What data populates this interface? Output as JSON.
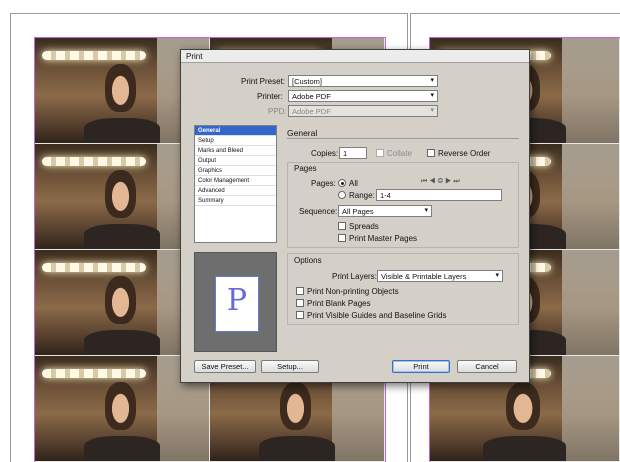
{
  "dialog": {
    "title": "Print",
    "print_preset_label": "Print Preset:",
    "print_preset_value": "[Custom]",
    "printer_label": "Printer:",
    "printer_value": "Adobe PDF",
    "ppd_label": "PPD:",
    "ppd_value": "Adobe PDF"
  },
  "sidebar": {
    "items": [
      {
        "label": "General"
      },
      {
        "label": "Setup"
      },
      {
        "label": "Marks and Bleed"
      },
      {
        "label": "Output"
      },
      {
        "label": "Graphics"
      },
      {
        "label": "Color Management"
      },
      {
        "label": "Advanced"
      },
      {
        "label": "Summary"
      }
    ],
    "selected": "General"
  },
  "preview": {
    "letter": "P"
  },
  "general": {
    "heading": "General",
    "copies_label": "Copies:",
    "copies_value": "1",
    "collate_label": "Collate",
    "reverse_order_label": "Reverse Order",
    "pages_heading": "Pages",
    "pages_label": "Pages:",
    "all_label": "All",
    "range_label": "Range:",
    "range_value": "1-4",
    "sequence_label": "Sequence:",
    "sequence_value": "All Pages",
    "spreads_label": "Spreads",
    "print_master_pages_label": "Print Master Pages"
  },
  "options": {
    "heading": "Options",
    "print_layers_label": "Print Layers:",
    "print_layers_value": "Visible & Printable Layers",
    "non_printing_label": "Print Non-printing Objects",
    "blank_pages_label": "Print Blank Pages",
    "visible_guides_label": "Print Visible Guides and Baseline Grids"
  },
  "buttons": {
    "save_preset": "Save Preset...",
    "setup": "Setup...",
    "print": "Print",
    "cancel": "Cancel"
  },
  "icons": {
    "pager": "page-navigation-icons",
    "dropdown": "chevron-down-icon"
  },
  "colors": {
    "selection": "#3366cc",
    "dialog_bg": "#d4d0c8",
    "frame_guides": "#c266d8"
  }
}
